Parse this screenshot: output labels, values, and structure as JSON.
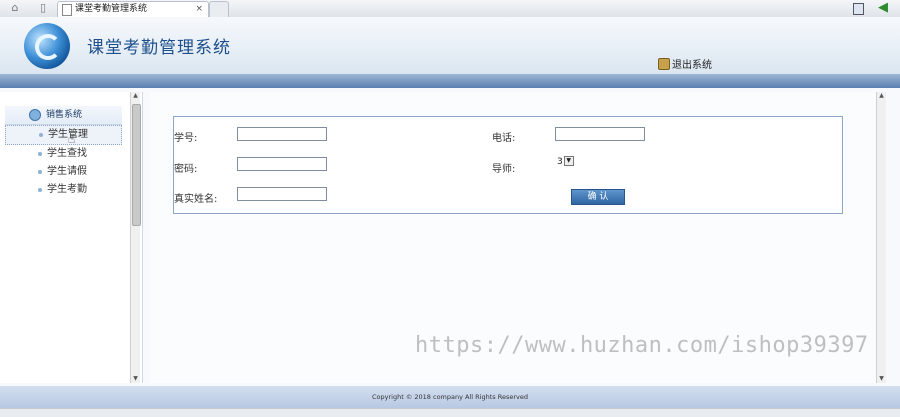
{
  "browser": {
    "tab_title": "课堂考勤管理系统",
    "tab_close": "×"
  },
  "header": {
    "app_title": "课堂考勤管理系统",
    "logout_label": "退出系统"
  },
  "sidebar": {
    "section_title": "销售系统",
    "items": [
      {
        "label": "学生管理",
        "active": true
      },
      {
        "label": "学生查找"
      },
      {
        "label": "学生请假"
      },
      {
        "label": "学生考勤"
      }
    ]
  },
  "form": {
    "student_id_label": "学号:",
    "student_id_value": "",
    "password_label": "密码:",
    "password_value": "",
    "real_name_label": "真实姓名:",
    "real_name_value": "",
    "phone_label": "电话:",
    "phone_value": "",
    "advisor_label": "导师:",
    "advisor_selected": "3",
    "submit_label": "确 认"
  },
  "footer": {
    "copyright": "Copyright © 2018 company All Rights Reserved"
  },
  "watermark": "https://www.huzhan.com/ishop39397",
  "colors": {
    "header_band": "#5a7fb0",
    "title_color": "#1e4f8c",
    "button": "#2f66a3"
  }
}
